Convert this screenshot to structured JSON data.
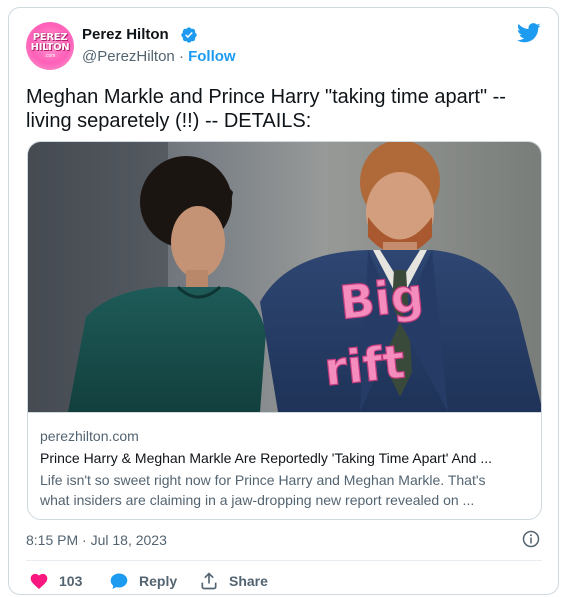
{
  "author": {
    "display_name": "Perez Hilton",
    "handle": "@PerezHilton",
    "separator": "·",
    "follow_label": "Follow",
    "avatar_logo": [
      "PEREZ",
      "HILTON",
      ".com"
    ],
    "verified": true
  },
  "tweet": {
    "text_line_1": "Meghan Markle and Prince Harry \"taking time apart\" --",
    "text_line_2": "living separetely (!!) -- DETAILS:"
  },
  "link_card": {
    "image_overlay_text": [
      "Big",
      "rift"
    ],
    "domain": "perezhilton.com",
    "title": "Prince Harry & Meghan Markle Are Reportedly 'Taking Time Apart' And ...",
    "description_line_1": "Life isn't so sweet right now for Prince Harry and Meghan Markle. That's",
    "description_line_2": "what insiders are claiming in a jaw-dropping new report revealed on ..."
  },
  "meta": {
    "timestamp": "8:15 PM · Jul 18, 2023"
  },
  "actions": {
    "like_count": "103",
    "reply_label": "Reply",
    "share_label": "Share"
  },
  "colors": {
    "accent": "#1d9bf0",
    "like": "#f91880",
    "text_primary": "#0f1419",
    "text_secondary": "#536471",
    "overlay_text": "#f48cbd"
  }
}
